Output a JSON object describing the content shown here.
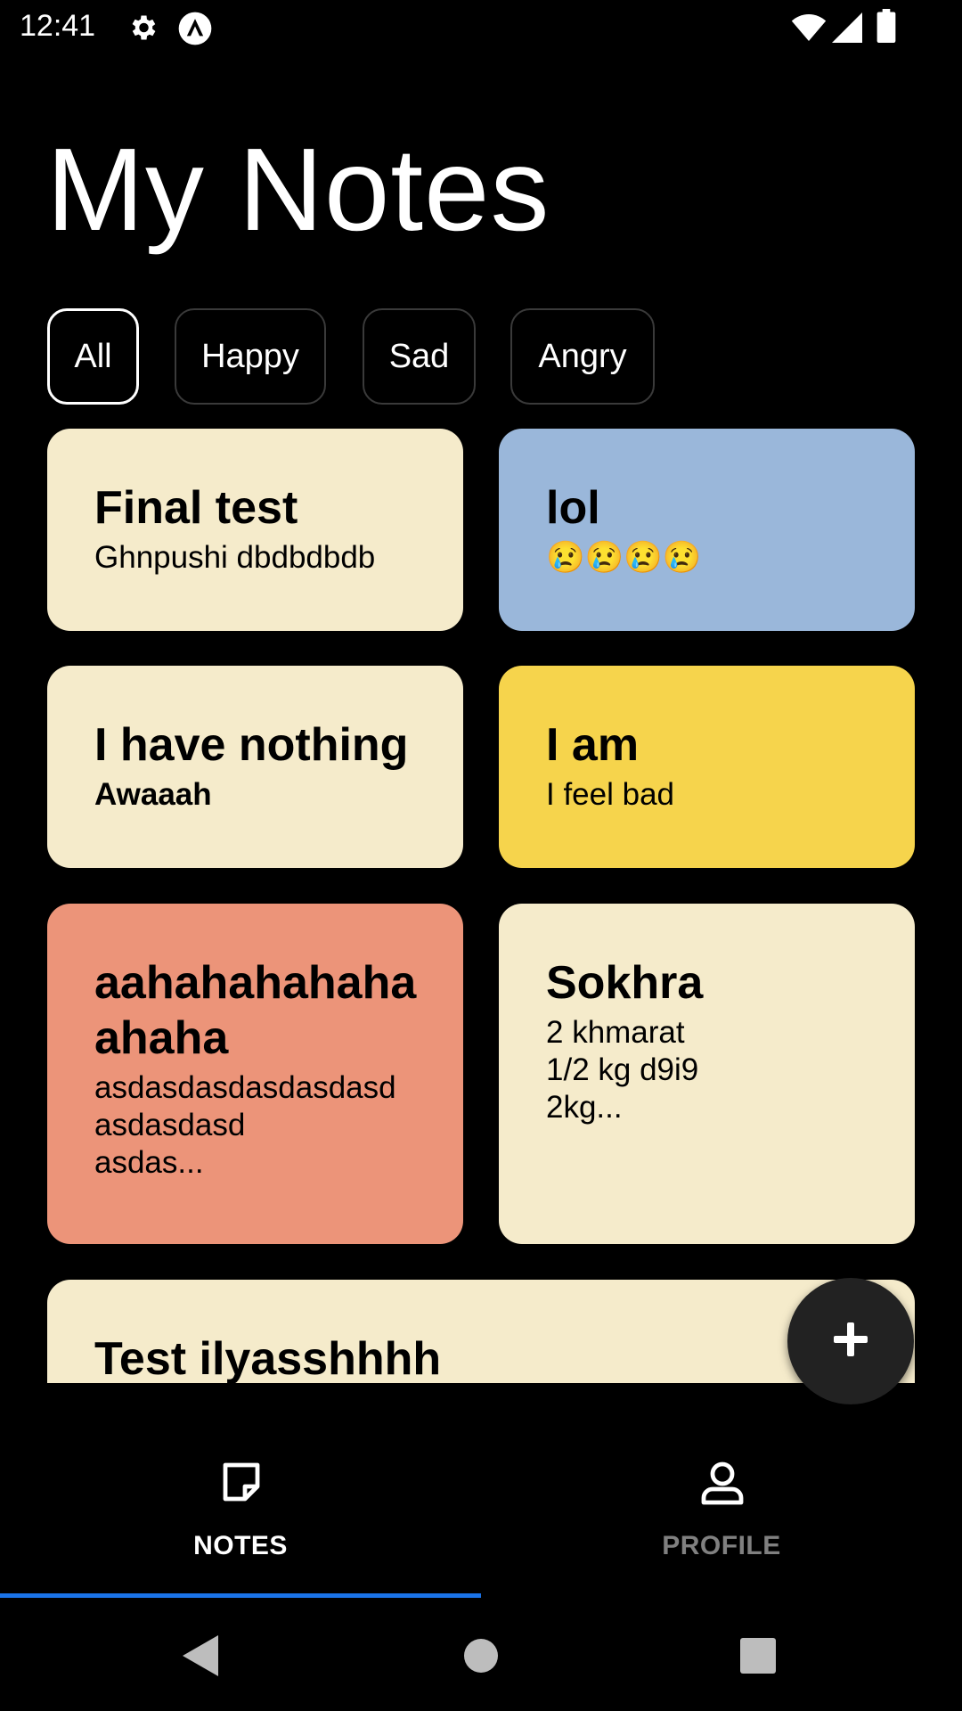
{
  "status_bar": {
    "time": "12:41",
    "icons": [
      "gear-icon",
      "app-logo-icon",
      "wifi-icon",
      "signal-icon",
      "battery-icon"
    ]
  },
  "page": {
    "title": "My Notes"
  },
  "filters": [
    {
      "label": "All",
      "selected": true
    },
    {
      "label": "Happy",
      "selected": false
    },
    {
      "label": "Sad",
      "selected": false
    },
    {
      "label": "Angry",
      "selected": false
    }
  ],
  "notes": [
    {
      "title": "Final test",
      "body": "Ghnpushi dbdbdbdb",
      "color": "#f5ebcb"
    },
    {
      "title": "lol",
      "body": "😢😢😢😢",
      "color": "#9ab7da"
    },
    {
      "title": "I have nothing",
      "body": "Awaaah",
      "color": "#f5ebcb"
    },
    {
      "title": "I am",
      "body": "I feel bad",
      "color": "#f6d44c"
    },
    {
      "title": "aahahahahaha\nahaha",
      "body": "asdasdasdasdasdasd\nasdasdasd\nasdas...",
      "color": "#ec9479"
    },
    {
      "title": "Sokhra",
      "body": "2 khmarat\n1/2 kg d9i9\n2kg...",
      "color": "#f5ebcb"
    },
    {
      "title": "Test ilyasshhhh",
      "body": "",
      "color": "#f5ebcb"
    }
  ],
  "fab": {
    "icon": "plus-icon"
  },
  "bottom_nav": {
    "tabs": [
      {
        "label": "NOTES",
        "icon": "note-icon",
        "active": true
      },
      {
        "label": "PROFILE",
        "icon": "person-icon",
        "active": false
      }
    ],
    "active_color": "#ffffff",
    "inactive_color": "#808080",
    "indicator_color": "#1a73e8"
  },
  "system_nav": {
    "icons": [
      "back-icon",
      "home-icon",
      "recents-icon"
    ]
  }
}
